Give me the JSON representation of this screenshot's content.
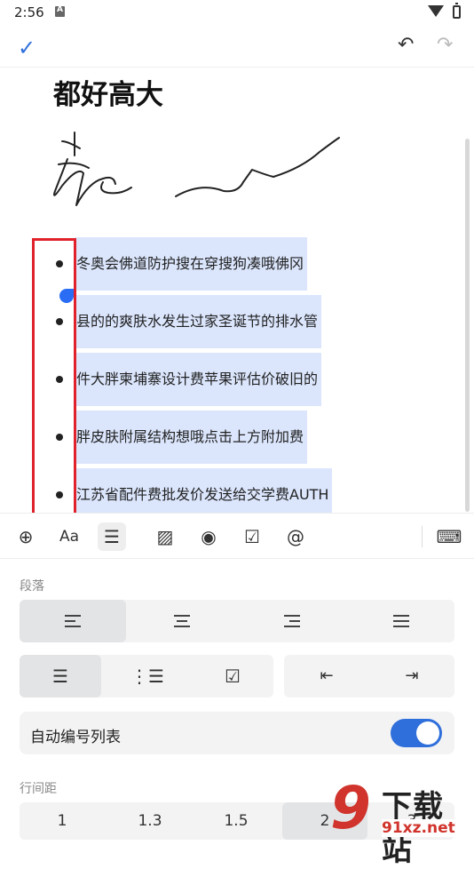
{
  "status_bar": {
    "time": "2:56"
  },
  "editor": {
    "title": "都好高大",
    "bullets": [
      "冬奥会佛道防护搜在穿搜狗凑哦佛冈",
      "县的的爽肤水发生过家圣诞节的排水管",
      "件大胖柬埔寨设计费苹果评估价破旧的",
      "胖皮肤附属结构想哦点击上方附加费",
      "江苏省配件费批发价发送给交学费AUTH"
    ]
  },
  "toolbar": {
    "icons": [
      "add-circle-icon",
      "font-style-icon",
      "paragraph-align-icon",
      "image-icon",
      "audio-icon",
      "checkbox-icon",
      "mention-icon",
      "keyboard-icon"
    ]
  },
  "panel": {
    "paragraph_label": "段落",
    "line_spacing_label": "行间距",
    "auto_number_label": "自动编号列表",
    "auto_number_on": true,
    "line_spacing_options": [
      "1",
      "1.3",
      "1.5",
      "2",
      "3"
    ],
    "selected_spacing": "2"
  },
  "watermark": {
    "text": "下载站",
    "url": "91xz.net",
    "digit": "9"
  },
  "colors": {
    "accent": "#2f6fdb",
    "selection": "#dbe6fd",
    "annotation": "#e0222c"
  }
}
